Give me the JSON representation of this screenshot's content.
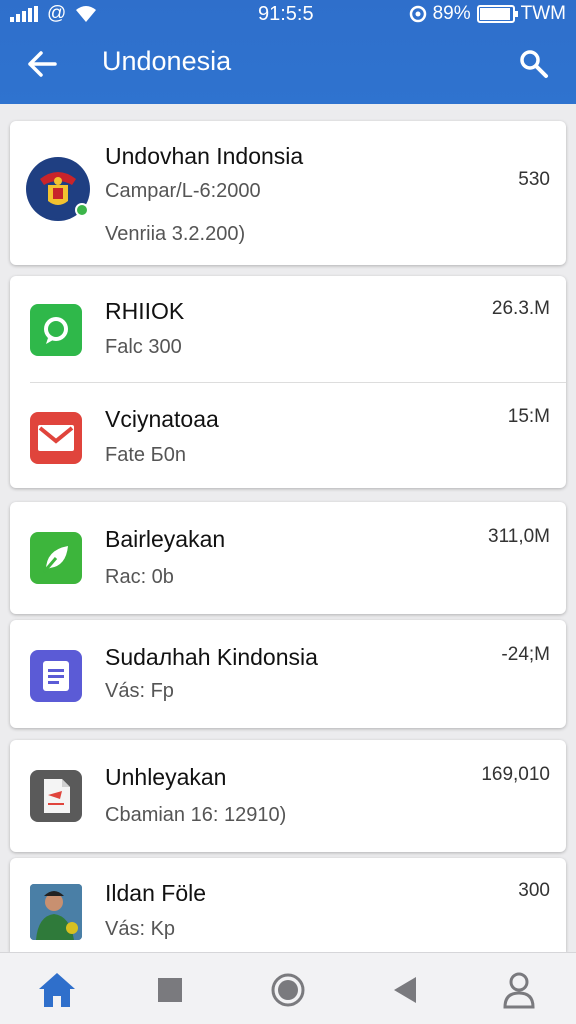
{
  "status_bar": {
    "time": "91:5:5",
    "left_extra": "@",
    "battery_text": "89%",
    "carrier": "TWM",
    "battery_level": 0.89
  },
  "header": {
    "title": "Undonesia"
  },
  "apps": [
    {
      "name": "Undovhan Indonsia",
      "subtitle": "Campar/L-6:2000",
      "subtitle2": "Venriia  3.2.200)",
      "size": "530",
      "icon": "coat-of-arms-icon"
    },
    {
      "name": "RHIIOK",
      "subtitle": "Falc 300",
      "size": "26.3.M",
      "icon": "chat-bubble-icon"
    },
    {
      "name": "Vciynatoaa",
      "subtitle": "Fate Б0n",
      "size": "15:M",
      "icon": "mail-icon"
    },
    {
      "name": "Bairleyakan",
      "subtitle": "Rac: 0b",
      "size": "311,0M",
      "icon": "leaf-icon"
    },
    {
      "name": "Sudaлhah Kindonsia",
      "subtitle": "Vás: Fp",
      "size": "-24;M",
      "icon": "document-icon"
    },
    {
      "name": "Unhleyakan",
      "subtitle": "Cbamian 16: 12910)",
      "size": "169,010",
      "icon": "file-icon"
    },
    {
      "name": "Ildan Föle",
      "subtitle": "Vás: Kp",
      "size": "300",
      "icon": "person-photo-icon"
    }
  ],
  "colors": {
    "header_blue": "#2f6fcb",
    "nav_active": "#2f6fcb",
    "chat_green": "#2fb84a",
    "mail_red": "#e0443c",
    "doc_purple": "#5b5bd6"
  }
}
